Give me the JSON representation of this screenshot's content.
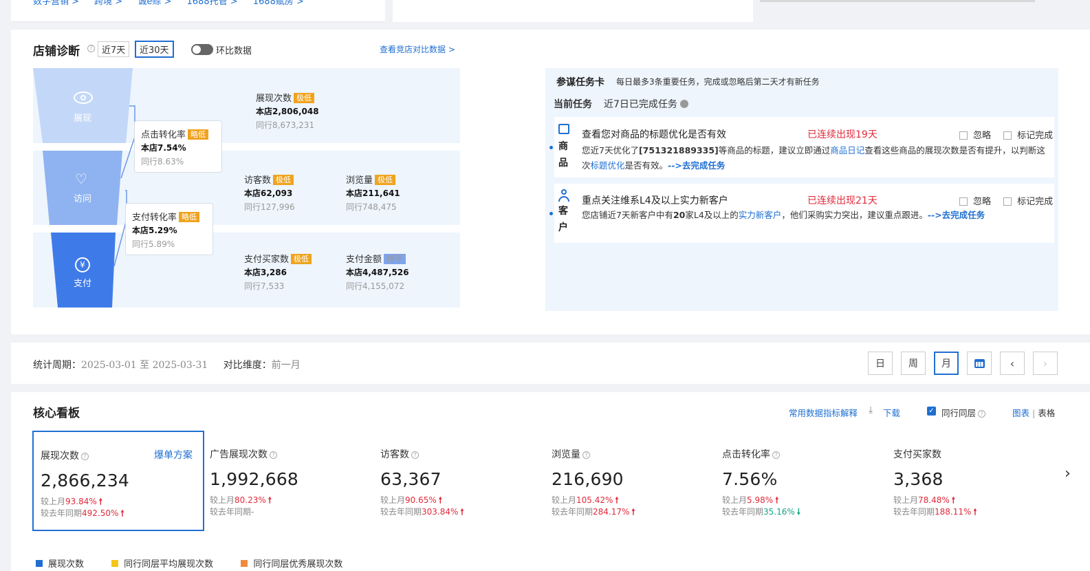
{
  "top_nav": {
    "items": [
      "数字营销 >",
      "跨境 >",
      "诚e赊 >",
      "1688托管 >",
      "1688赋房 >"
    ]
  },
  "diag": {
    "title": "店铺诊断",
    "tab7": "近7天",
    "tab30": "近30天",
    "toggle_label": "环比数据",
    "compare_link": "查看竞店对比数据 >",
    "funnel": {
      "show": "展现",
      "visit": "访问",
      "pay": "支付"
    },
    "ctr": {
      "label": "点击转化率",
      "tag": "略低",
      "store": "本店7.54%",
      "peer": "同行8.63%"
    },
    "pcr": {
      "label": "支付转化率",
      "tag": "略低",
      "store": "本店5.29%",
      "peer": "同行5.89%"
    },
    "impressions": {
      "label": "展现次数",
      "tag": "极低",
      "store": "本店2,806,048",
      "peer": "同行8,673,231"
    },
    "visitors": {
      "label": "访客数",
      "tag": "极低",
      "store": "本店62,093",
      "peer": "同行127,996"
    },
    "views": {
      "label": "浏览量",
      "tag": "极低",
      "store": "本店211,641",
      "peer": "同行748,475"
    },
    "buyers": {
      "label": "支付买家数",
      "tag": "极低",
      "store": "本店3,286",
      "peer": "同行7,533"
    },
    "amount": {
      "label": "支付金额",
      "tag": "持平",
      "store": "本店4,487,526",
      "peer": "同行4,155,072"
    }
  },
  "task": {
    "title": "参谋任务卡",
    "subtitle": "每日最多3条重要任务，完成或忽略后第二天才有新任务",
    "current": "当前任务",
    "done": "近7日已完成任务",
    "ignore": "忽略",
    "mark": "标记完成",
    "goods": {
      "cat1": "商",
      "cat2": "品",
      "title": "查看您对商品的标题优化是否有效",
      "streak": "已连续出现19天",
      "d1": "您近7天优化了",
      "d2": "[751321889335]",
      "d3": "等商品的标题，建议立即通过",
      "d4": "商品日记",
      "d5": "查看这些商品的展现次数是否有提升，以判断",
      "d6": "这次",
      "d7": "标题优化",
      "d8": "是否有效。",
      "d9": "-->去完成任务"
    },
    "customer": {
      "cat1": "客",
      "cat2": "户",
      "title": "重点关注维系L4及以上实力新客户",
      "streak": "已连续出现21天",
      "d1": "您店铺近7天新客户中有",
      "d2": "20",
      "d3": "家L4及以上的",
      "d4": "实力新客户",
      "d5": "，他们采购实力突出，建议重点跟进。",
      "d6": "-->去完成任务"
    }
  },
  "period": {
    "label": "统计周期：",
    "value": "2025-03-01 至 2025-03-31",
    "cmp_label": "对比维度：",
    "cmp_value": "前一月",
    "day": "日",
    "week": "周",
    "month": "月"
  },
  "board": {
    "title": "核心看板",
    "explain": "常用数据指标解释",
    "download": "下载",
    "peer": "同行同层",
    "chart": "图表",
    "sep": "|",
    "table": "表格",
    "plan": "爆单方案",
    "kpis": [
      {
        "name": "展现次数",
        "value": "2,866,234",
        "m_label": "较上月",
        "m_val": "93.84%",
        "y_label": "较去年同期",
        "y_val": "492.50%"
      },
      {
        "name": "广告展现次数",
        "value": "1,992,668",
        "m_label": "较上月",
        "m_val": "80.23%",
        "y_label": "较去年同期",
        "y_val": "-"
      },
      {
        "name": "访客数",
        "value": "63,367",
        "m_label": "较上月",
        "m_val": "90.65%",
        "y_label": "较去年同期",
        "y_val": "303.84%"
      },
      {
        "name": "浏览量",
        "value": "216,690",
        "m_label": "较上月",
        "m_val": "105.42%",
        "y_label": "较去年同期",
        "y_val": "284.17%"
      },
      {
        "name": "点击转化率",
        "value": "7.56%",
        "m_label": "较上月",
        "m_val": "5.98%",
        "y_label": "较去年同期",
        "y_val": "35.16%"
      },
      {
        "name": "支付买家数",
        "value": "3,368",
        "m_label": "较上月",
        "m_val": "78.48%",
        "y_label": "较去年同期",
        "y_val": "188.11%"
      }
    ],
    "legend": [
      "展现次数",
      "同行同层平均展现次数",
      "同行同层优秀展现次数"
    ]
  },
  "colors": {
    "accent": "#1f6fd1",
    "up": "#e0293a",
    "down": "#13a58a",
    "tag": "#f0a31e",
    "funnel1": "#c3d7f8",
    "funnel2": "#8fb3f0",
    "funnel3": "#3f7be8"
  }
}
